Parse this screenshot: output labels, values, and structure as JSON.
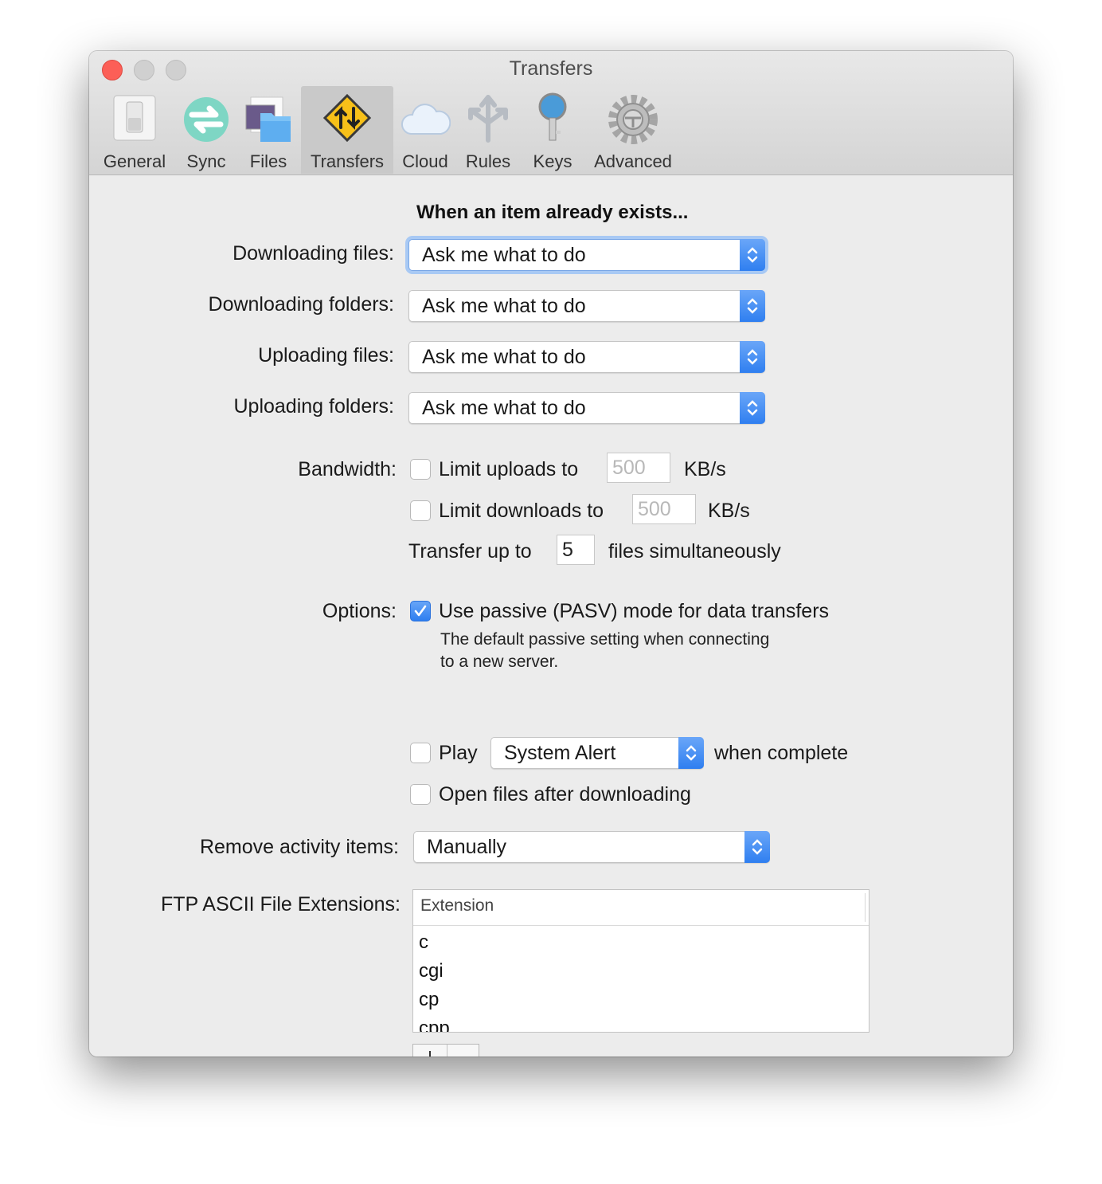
{
  "window": {
    "title": "Transfers"
  },
  "toolbar": {
    "items": [
      {
        "label": "General",
        "icon": "switch-icon"
      },
      {
        "label": "Sync",
        "icon": "sync-icon"
      },
      {
        "label": "Files",
        "icon": "files-icon"
      },
      {
        "label": "Transfers",
        "icon": "transfers-icon",
        "active": true
      },
      {
        "label": "Cloud",
        "icon": "cloud-icon"
      },
      {
        "label": "Rules",
        "icon": "rules-icon"
      },
      {
        "label": "Keys",
        "icon": "key-icon"
      },
      {
        "label": "Advanced",
        "icon": "gear-icon"
      }
    ]
  },
  "exists": {
    "heading": "When an item already exists...",
    "rows": [
      {
        "label": "Downloading files:",
        "value": "Ask me what to do"
      },
      {
        "label": "Downloading folders:",
        "value": "Ask me what to do"
      },
      {
        "label": "Uploading files:",
        "value": "Ask me what to do"
      },
      {
        "label": "Uploading folders:",
        "value": "Ask me what to do"
      }
    ]
  },
  "bandwidth": {
    "label": "Bandwidth:",
    "limit_uploads_label": "Limit uploads to",
    "limit_uploads_checked": false,
    "uploads_value": "500",
    "uploads_unit": "KB/s",
    "limit_downloads_label": "Limit downloads to",
    "limit_downloads_checked": false,
    "downloads_value": "500",
    "downloads_unit": "KB/s",
    "transfer_prefix": "Transfer up to",
    "transfer_value": "5",
    "transfer_suffix": "files simultaneously"
  },
  "options": {
    "label": "Options:",
    "passive_label": "Use passive (PASV) mode for data transfers",
    "passive_checked": true,
    "passive_note_line1": "The default passive setting when connecting",
    "passive_note_line2": "to a new server.",
    "play_label": "Play",
    "play_checked": false,
    "sound_value": "System Alert",
    "play_suffix": "when complete",
    "open_files_label": "Open files after downloading",
    "open_files_checked": false
  },
  "remove_activity": {
    "label": "Remove activity items:",
    "value": "Manually"
  },
  "ascii": {
    "label": "FTP ASCII File Extensions:",
    "column_header": "Extension",
    "rows": [
      "c",
      "cgi",
      "cp",
      "cpp"
    ],
    "add_label": "+",
    "remove_label": "−"
  },
  "colors": {
    "accent": "#2f7ff0",
    "window_bg": "#ececec",
    "close": "#fc5f57"
  }
}
